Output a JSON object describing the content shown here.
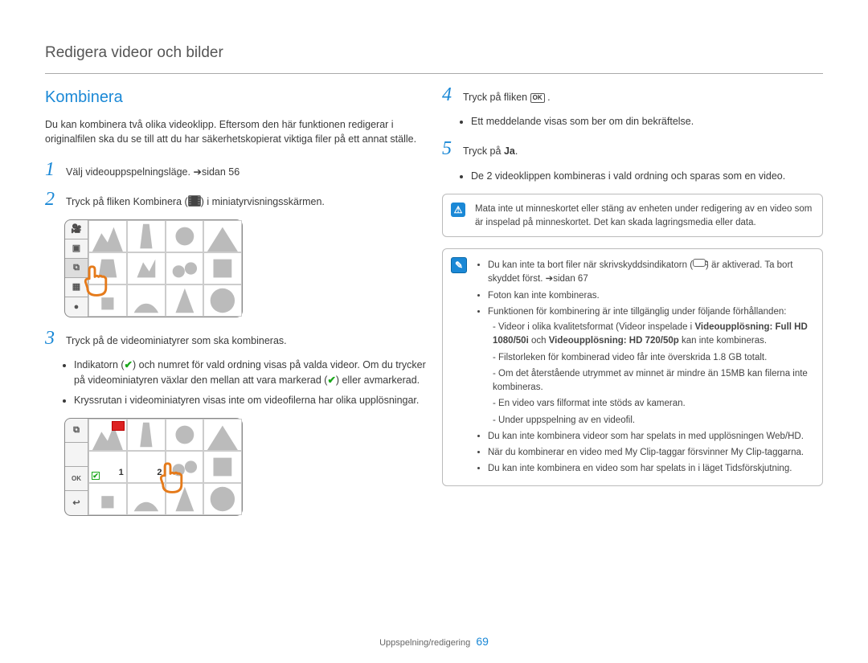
{
  "page": {
    "title": "Redigera videor och bilder",
    "footer_section": "Uppspelning/redigering",
    "footer_page": "69"
  },
  "section": {
    "heading": "Kombinera",
    "intro": "Du kan kombinera två olika videoklipp. Eftersom den här funktionen redigerar i originalfilen ska du se till att du har säkerhetskopierat viktiga filer på ett annat ställe."
  },
  "steps": {
    "s1": {
      "num": "1",
      "text_a": "Välj videouppspelningsläge. ",
      "arrow": "➔",
      "text_b": "sidan 56"
    },
    "s2": {
      "num": "2",
      "text_a": "Tryck på fliken Kombinera (",
      "text_b": ") i miniatyrvisningsskärmen."
    },
    "s3": {
      "num": "3",
      "text": "Tryck på de videominiatyrer som ska kombineras."
    },
    "s3_b1a": "Indikatorn (",
    "s3_b1b": ") och numret för vald ordning visas på valda videor. Om du trycker på videominiatyren växlar den mellan att vara markerad (",
    "s3_b1c": ") eller avmarkerad.",
    "s3_b2": "Kryssrutan i videominiatyren visas inte om videofilerna har olika upplösningar.",
    "s4": {
      "num": "4",
      "text_a": "Tryck på fliken ",
      "text_b": " ."
    },
    "s4_b1": "Ett meddelande visas som ber om din bekräftelse.",
    "s5": {
      "num": "5",
      "text_a": "Tryck på ",
      "text_b": "Ja",
      "text_c": "."
    },
    "s5_b1": "De 2 videoklippen kombineras i vald ordning och sparas som en video."
  },
  "warning": {
    "text": "Mata inte ut minneskortet eller stäng av enheten under redigering av en video som är inspelad på minneskortet. Det kan skada lagringsmedia eller data."
  },
  "notes": {
    "n1a": "Du kan inte ta bort filer när skrivskyddsindikatorn (",
    "n1b": ") är aktiverad. Ta bort skyddet först. ",
    "n1_ref": "sidan 67",
    "n2": "Foton kan inte kombineras.",
    "n3": "Funktionen för kombinering är inte tillgänglig under följande förhållanden:",
    "n3a_a": "Videor i olika kvalitetsformat (Videor inspelade i ",
    "n3a_bold1": "Videoupplösning: Full HD 1080/50i",
    "n3a_mid": " och ",
    "n3a_bold2": "Videoupplösning: HD 720/50p",
    "n3a_b": " kan inte kombineras.",
    "n3b": "Filstorleken för kombinerad video får inte överskrida 1.8 GB totalt.",
    "n3c": "Om det återstående utrymmet av minnet är mindre än 15MB kan filerna inte kombineras.",
    "n3d": "En video vars filformat inte stöds av kameran.",
    "n3e": "Under uppspelning av en videofil.",
    "n4": "Du kan inte kombinera videor som har spelats in med upplösningen Web/HD.",
    "n5": "När du kombinerar en video med My Clip-taggar försvinner My Clip-taggarna.",
    "n6": "Du kan inte kombinera en video som har spelats in i läget Tidsförskjutning."
  },
  "screens": {
    "s1_sidebar": [
      "🎥",
      "▣",
      "⧉",
      "▦",
      "●"
    ],
    "s2_sidebar": [
      "⧉",
      "",
      "OK",
      "↩"
    ],
    "badges": {
      "b1": "1",
      "b2": "2"
    },
    "ok_label": "OK"
  }
}
